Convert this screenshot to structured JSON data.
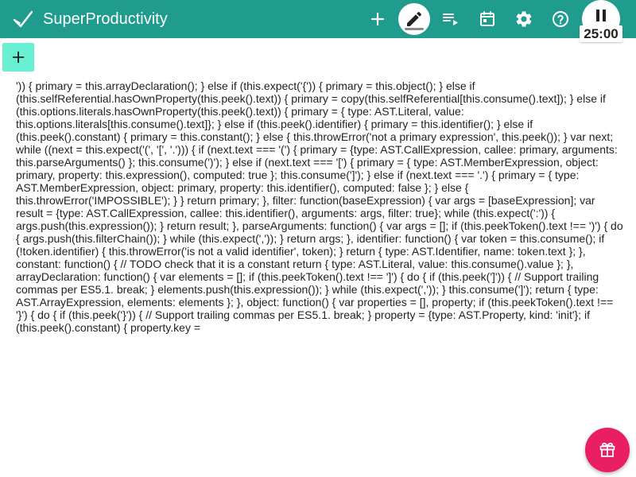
{
  "toolbar": {
    "app_title": "SuperProductivity",
    "timer": "25:00",
    "background": "#1f9c8e"
  },
  "icons": {
    "logo": "check-logo",
    "add": "plus-icon",
    "edit": "pencil-icon",
    "work_view": "playlist-icon",
    "schedule": "calendar-icon",
    "settings": "gear-icon",
    "help": "help-icon",
    "play_pause": "pause-icon",
    "add_task": "plus-icon",
    "fab": "gift-icon"
  },
  "colors": {
    "accent": "#69f0d2",
    "fab": "#e91e63"
  },
  "content": {
    "code_text": "')) { primary = this.arrayDeclaration(); } else if (this.expect('{')) { primary = this.object(); } else if (this.selfReferential.hasOwnProperty(this.peek().text)) { primary = copy(this.selfReferential[this.consume().text]); } else if (this.options.literals.hasOwnProperty(this.peek().text)) { primary = { type: AST.Literal, value: this.options.literals[this.consume().text]}; } else if (this.peek().identifier) { primary = this.identifier(); } else if (this.peek().constant) { primary = this.constant(); } else { this.throwError('not a primary expression', this.peek()); } var next; while ((next = this.expect('(', '[', '.'))) { if (next.text === '(') { primary = {type: AST.CallExpression, callee: primary, arguments: this.parseArguments() }; this.consume(')'); } else if (next.text === '[') { primary = { type: AST.MemberExpression, object: primary, property: this.expression(), computed: true }; this.consume(']'); } else if (next.text === '.') { primary = { type: AST.MemberExpression, object: primary, property: this.identifier(), computed: false }; } else { this.throwError('IMPOSSIBLE'); } } return primary; }, filter: function(baseExpression) { var args = [baseExpression]; var result = {type: AST.CallExpression, callee: this.identifier(), arguments: args, filter: true}; while (this.expect(':')) { args.push(this.expression()); } return result; }, parseArguments: function() { var args = []; if (this.peekToken().text !== ')') { do { args.push(this.filterChain()); } while (this.expect(',')); } return args; }, identifier: function() { var token = this.consume(); if (!token.identifier) { this.throwError('is not a valid identifier', token); } return { type: AST.Identifier, name: token.text }; }, constant: function() { // TODO check that it is a constant return { type: AST.Literal, value: this.consume().value }; }, arrayDeclaration: function() { var elements = []; if (this.peekToken().text !== ']') { do { if (this.peek(']')) { // Support trailing commas per ES5.1. break; } elements.push(this.expression()); } while (this.expect(',')); } this.consume(']'); return { type: AST.ArrayExpression, elements: elements }; }, object: function() { var properties = [], property; if (this.peekToken().text !== '}') { do { if (this.peek('}')) { // Support trailing commas per ES5.1. break; } property = {type: AST.Property, kind: 'init'}; if (this.peek().constant) { property.key ="
  }
}
